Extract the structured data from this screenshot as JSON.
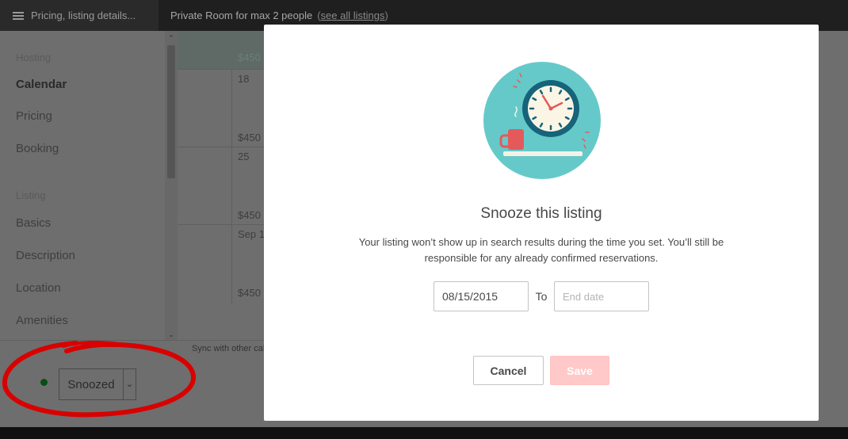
{
  "topbar": {
    "menu_label": "Pricing, listing details...",
    "listing_title": "Private Room for max 2 people",
    "see_all_open": "(",
    "see_all_label": "see all listings",
    "see_all_close": ")"
  },
  "sidebar": {
    "hosting_heading": "Hosting",
    "hosting_items": [
      {
        "label": "Calendar"
      },
      {
        "label": "Pricing"
      },
      {
        "label": "Booking"
      }
    ],
    "listing_heading": "Listing",
    "listing_items": [
      {
        "label": "Basics"
      },
      {
        "label": "Description"
      },
      {
        "label": "Location"
      },
      {
        "label": "Amenities"
      }
    ]
  },
  "calendar": {
    "top_price": "$450",
    "rows": [
      {
        "date": "18",
        "price": "$450"
      },
      {
        "date": "25",
        "price": "$450"
      },
      {
        "date": "Sep 1",
        "price": "$450"
      }
    ],
    "sync_text": "Sync with other calendars"
  },
  "status": {
    "value": "Snoozed",
    "dot_color": "#0a4d14"
  },
  "modal": {
    "title": "Snooze this listing",
    "description": "Your listing won’t show up in search results during the time you set. You’ll still be responsible for any already confirmed reservations.",
    "start_date_value": "08/15/2015",
    "to_label": "To",
    "end_date_placeholder": "End date",
    "cancel_label": "Cancel",
    "save_label": "Save"
  },
  "colors": {
    "brand_accent": "#ff5a5f",
    "save_disabled": "#ffc9c9",
    "illustration_bg": "#66c9c9",
    "annotation_red": "#d90000"
  }
}
